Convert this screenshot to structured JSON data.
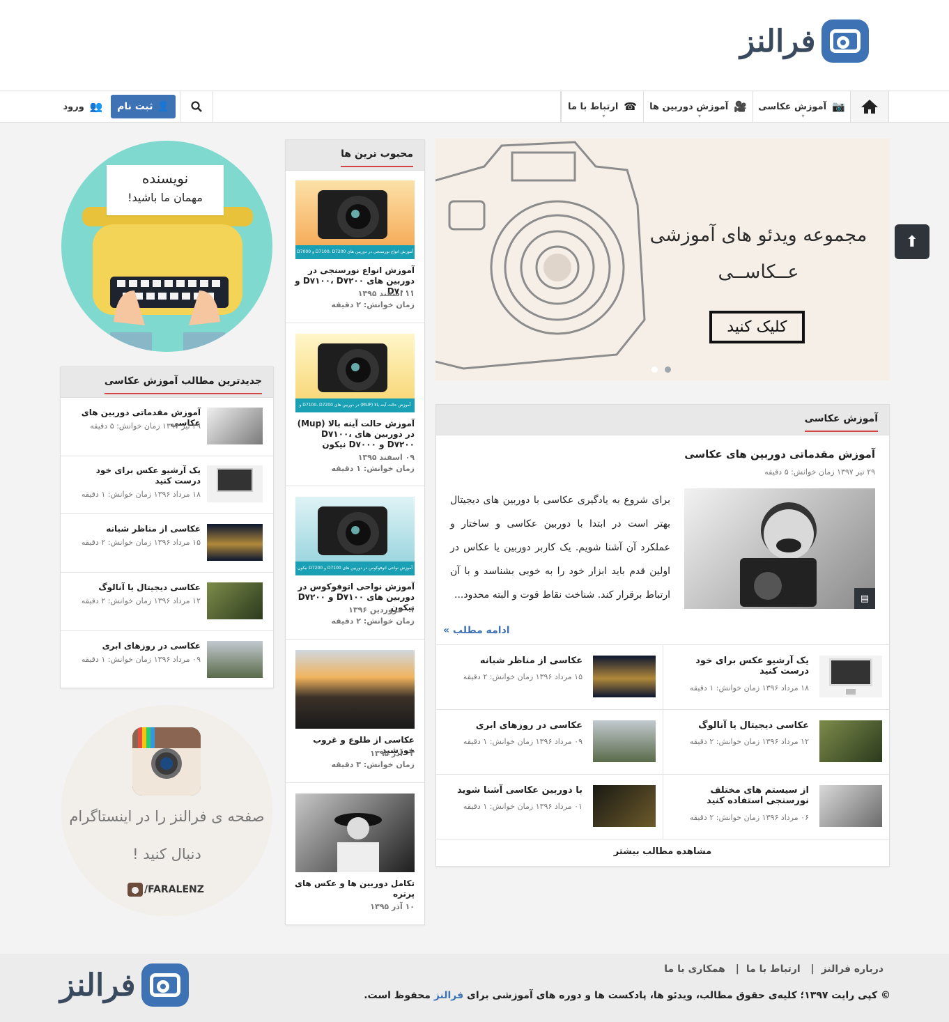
{
  "site": {
    "logo_text": "فرالنز"
  },
  "nav": {
    "home_label": "خانه",
    "items": [
      {
        "label": "آموزش عکاسی"
      },
      {
        "label": "آموزش دوربین ها"
      },
      {
        "label": "ارتباط با ما"
      }
    ],
    "register_label": "ثبت نام",
    "login_label": "ورود"
  },
  "slider": {
    "title": "مجموعه ویدئو های آموزشی عــکاســی",
    "button_label": "کلیک کنید",
    "slide_count": 2,
    "active_index": 1
  },
  "learn_section": {
    "title": "آموزش عکاسی",
    "featured": {
      "title": "آموزش مقدماتی دوربین های عکاسی",
      "meta": "۲۹ تیر ۱۳۹۷   زمان خوانش: ۵ دقیقه",
      "excerpt": "برای شروع به یادگیری عکاسی با دوربین های دیجیتال بهتر است در ابتدا با دوربین عکاسی و ساختار و عملکرد آن آشنا شویم. یک کاربر دوربین یا عکاس در اولین قدم باید ابزار خود را به خوبی بشناسد و با آن ارتباط برقرار کند. شناخت نقاط قوت و البته محدود...",
      "more_label": "ادامه مطلب »"
    },
    "grid": [
      {
        "title": "یک آرشیو عکس برای خود درست کنید",
        "meta": "۱۸ مرداد ۱۳۹۶   زمان خوانش: ۱ دقیقه"
      },
      {
        "title": "عکاسی از مناظر شبانه",
        "meta": "۱۵ مرداد ۱۳۹۶   زمان خوانش: ۲ دقیقه"
      },
      {
        "title": "عکاسی دیجیتال یا آنالوگ",
        "meta": "۱۲ مرداد ۱۳۹۶   زمان خوانش: ۲ دقیقه"
      },
      {
        "title": "عکاسی در روزهای ابری",
        "meta": "۰۹ مرداد ۱۳۹۶   زمان خوانش: ۱ دقیقه"
      },
      {
        "title": "از سیستم های مختلف نورسنجی استفاده کنید",
        "meta": "۰۶ مرداد ۱۳۹۶   زمان خوانش: ۲ دقیقه"
      },
      {
        "title": "با دوربین عکاسی آشنا شوید",
        "meta": "۰۱ مرداد ۱۳۹۶   زمان خوانش: ۱ دقیقه"
      }
    ],
    "see_more_label": "مشاهده مطالب بیشتر"
  },
  "popular": {
    "title": "محبوب ترین ها",
    "items": [
      {
        "title": "آموزش انواع نورسنجی در دوربین های D۷۱۰۰، D۷۲۰۰ و D۷۰۰۰",
        "date": "۱۱ اسفند ۱۳۹۵",
        "read": "زمان خوانش: ۲ دقیقه",
        "thumb_caption": "آموزش انواع نورسنجی در دوربین های D7100، D7200 و D7000"
      },
      {
        "title": "آموزش حالت آینه بالا (Mup) در دوربین های D۷۱۰۰، D۷۲۰۰ و D۷۰۰۰ نیکون",
        "date": "۰۹ اسفند ۱۳۹۵",
        "read": "زمان خوانش: ۱ دقیقه",
        "thumb_caption": "آموزش حالت آینه بالا (MUP) در دوربین های D7100، D7200 و D7000 نیکون"
      },
      {
        "title": "آموزش نواحی اتوفوکوس در دوربین های D۷۱۰۰ و D۷۲۰۰ نیکون",
        "date": "۰۱ فروردین ۱۳۹۶",
        "read": "زمان خوانش: ۲ دقیقه",
        "thumb_caption": "آموزش نواحی اتوفوکوس در دوربین های D7100 و D7200 نیکون"
      },
      {
        "title": "عکاسی از طلوع و غروب خورشید",
        "date": "۰۳ آذر ۱۳۹۵",
        "read": "زمان خوانش: ۳ دقیقه"
      },
      {
        "title": "تکامل دوربین ها و عکس های پرتره",
        "date": "۱۰ آذر ۱۳۹۵",
        "read": ""
      }
    ]
  },
  "guest_writer": {
    "line1": "نویسنده",
    "line2": "مهمان ما باشید!"
  },
  "latest": {
    "title": "جدیدترین مطالب آموزش عکاسی",
    "items": [
      {
        "title": "آموزش مقدماتی دوربین های عکاسی",
        "meta": "۲۹ تیر ۱۳۹۷   زمان خوانش: ۵ دقیقه"
      },
      {
        "title": "یک آرشیو عکس برای خود درست کنید",
        "meta": "۱۸ مرداد ۱۳۹۶   زمان خوانش: ۱ دقیقه"
      },
      {
        "title": "عکاسی از مناظر شبانه",
        "meta": "۱۵ مرداد ۱۳۹۶   زمان خوانش: ۲ دقیقه"
      },
      {
        "title": "عکاسی دیجیتال یا آنالوگ",
        "meta": "۱۲ مرداد ۱۳۹۶   زمان خوانش: ۲ دقیقه"
      },
      {
        "title": "عکاسی در روزهای ابری",
        "meta": "۰۹ مرداد ۱۳۹۶   زمان خوانش: ۱ دقیقه"
      }
    ]
  },
  "instagram": {
    "line1": "صفحه ی فرالنز را در اینستاگرام",
    "line2": "دنبال کنید !",
    "handle": "/FARALENZ"
  },
  "footer": {
    "links": [
      "درباره فرالنز",
      "ارتباط با ما",
      "همکاری با ما"
    ],
    "copyright_pre": "© کپی رایت ۱۳۹۷؛ کلیه‌ی حقوق مطالب، ویدئو ها، پادکست ها و دوره های آموزشی برای ",
    "copyright_brand": "فرالنز",
    "copyright_post": " محفوظ است.",
    "logo_text": "فرالنز"
  },
  "colors": {
    "brand": "#3d72b5",
    "accent_red": "#d64545",
    "dark": "#2f343b"
  }
}
